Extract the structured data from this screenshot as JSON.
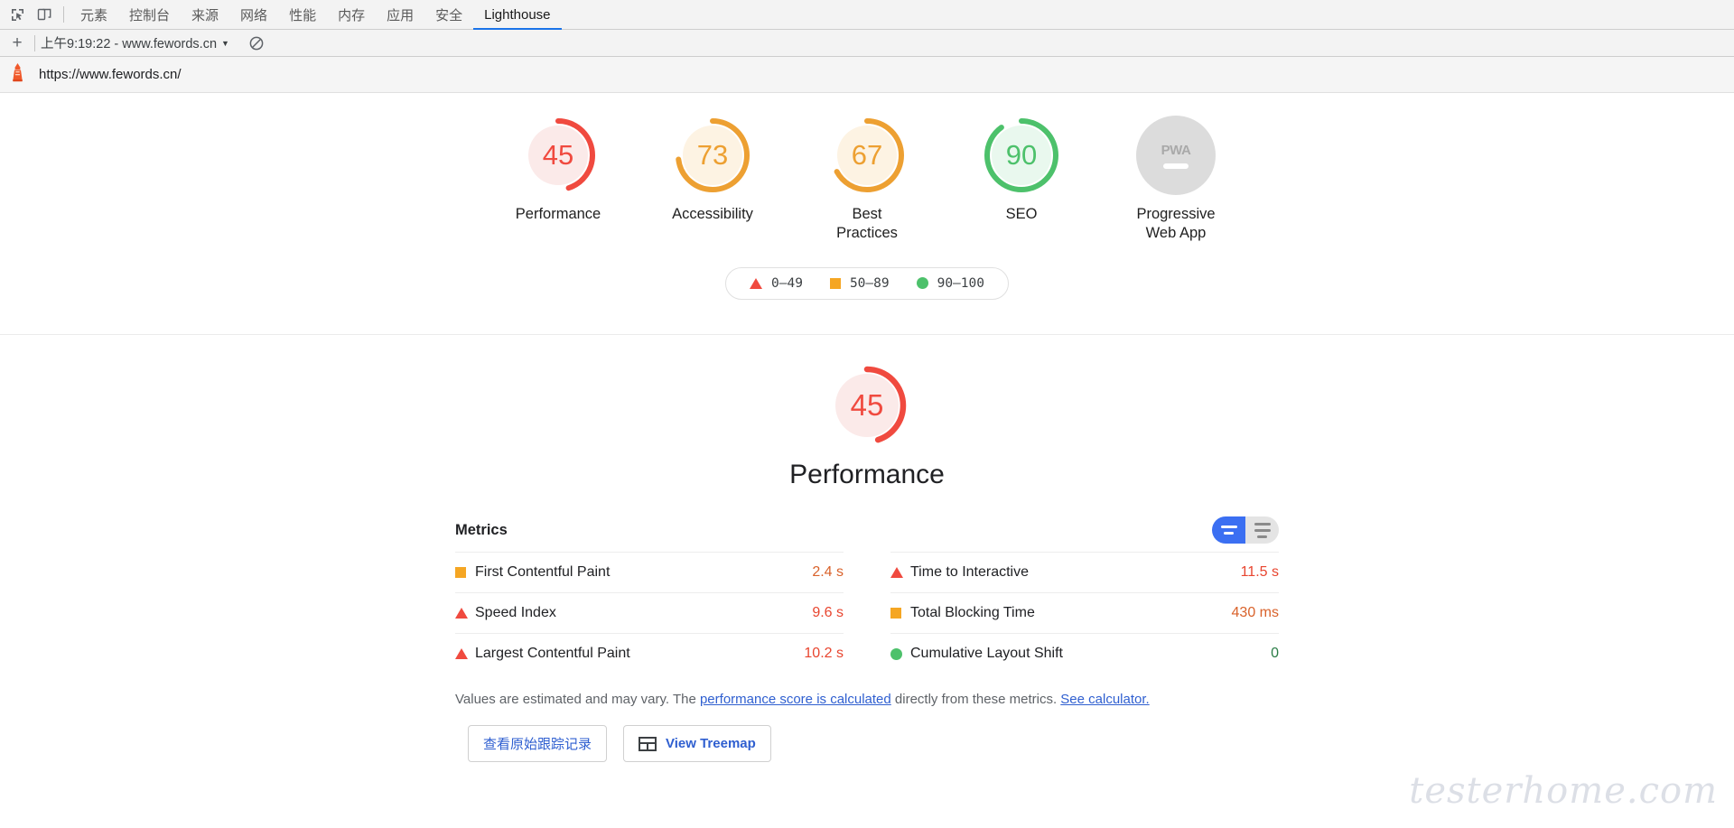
{
  "devtools": {
    "icons": {
      "inspect": "inspect-element-icon",
      "device": "device-toolbar-icon"
    },
    "tabs": [
      {
        "label": "元素",
        "selected": false
      },
      {
        "label": "控制台",
        "selected": false
      },
      {
        "label": "来源",
        "selected": false
      },
      {
        "label": "网络",
        "selected": false
      },
      {
        "label": "性能",
        "selected": false
      },
      {
        "label": "内存",
        "selected": false
      },
      {
        "label": "应用",
        "selected": false
      },
      {
        "label": "安全",
        "selected": false
      },
      {
        "label": "Lighthouse",
        "selected": true
      }
    ]
  },
  "lh_toolbar": {
    "add_label": "+",
    "run_label": "上午9:19:22 - www.fewords.cn",
    "caret": "▼",
    "clear_icon": "clear-all-icon"
  },
  "url_bar": {
    "icon": "lighthouse-logo-icon",
    "url": "https://www.fewords.cn/"
  },
  "chart_data": {
    "type": "gauge",
    "title": "Lighthouse category scores",
    "categories": [
      "Performance",
      "Accessibility",
      "Best Practices",
      "SEO",
      "Progressive Web App"
    ],
    "values": [
      45,
      73,
      67,
      90,
      null
    ],
    "ylim": [
      0,
      100
    ],
    "legend": [
      "0–49",
      "50–89",
      "90–100"
    ],
    "colors": {
      "fail": "#f04a3f",
      "average": "#f5a623",
      "pass": "#4dc16b",
      "null": "#dcdcdc"
    }
  },
  "gauges": [
    {
      "score": "45",
      "label": "Performance",
      "value": 45,
      "band": "fail"
    },
    {
      "score": "73",
      "label": "Accessibility",
      "value": 73,
      "band": "average"
    },
    {
      "score": "67",
      "label": "Best\nPractices",
      "value": 67,
      "band": "average"
    },
    {
      "score": "90",
      "label": "SEO",
      "value": 90,
      "band": "pass"
    },
    {
      "score": "PWA",
      "label": "Progressive\nWeb App",
      "value": null,
      "band": "null"
    }
  ],
  "gauge_labels": {
    "performance": "Performance",
    "accessibility": "Accessibility",
    "best_practices_line1": "Best",
    "best_practices_line2": "Practices",
    "seo": "SEO",
    "pwa_line1": "Progressive",
    "pwa_line2": "Web App",
    "pwa_badge": "PWA"
  },
  "gauge_scores": {
    "performance": "45",
    "accessibility": "73",
    "best_practices": "67",
    "seo": "90"
  },
  "legend": {
    "fail": "0–49",
    "average": "50–89",
    "pass": "90–100"
  },
  "category": {
    "score": "45",
    "title": "Performance"
  },
  "metrics": {
    "heading": "Metrics",
    "toggle": {
      "compact_label": "toggle-compact",
      "expanded_label": "toggle-expanded",
      "selected": "compact"
    },
    "left_column": [
      {
        "label": "First Contentful Paint",
        "value": "2.4 s",
        "band": "average"
      },
      {
        "label": "Speed Index",
        "value": "9.6 s",
        "band": "fail"
      },
      {
        "label": "Largest Contentful Paint",
        "value": "10.2 s",
        "band": "fail"
      }
    ],
    "right_column": [
      {
        "label": "Time to Interactive",
        "value": "11.5 s",
        "band": "fail"
      },
      {
        "label": "Total Blocking Time",
        "value": "430 ms",
        "band": "average"
      },
      {
        "label": "Cumulative Layout Shift",
        "value": "0",
        "band": "pass"
      }
    ]
  },
  "metric_rows": {
    "l0_label": "First Contentful Paint",
    "l0_value": "2.4 s",
    "l1_label": "Speed Index",
    "l1_value": "9.6 s",
    "l2_label": "Largest Contentful Paint",
    "l2_value": "10.2 s",
    "r0_label": "Time to Interactive",
    "r0_value": "11.5 s",
    "r1_label": "Total Blocking Time",
    "r1_value": "430 ms",
    "r2_label": "Cumulative Layout Shift",
    "r2_value": "0"
  },
  "footnote": {
    "part1": "Values are estimated and may vary. The ",
    "link1": "performance score is calculated",
    "part2": " directly from these metrics. ",
    "link2": "See calculator."
  },
  "buttons": {
    "view_trace": "查看原始跟踪记录",
    "view_treemap": "View Treemap",
    "treemap_icon": "treemap-icon"
  },
  "watermark": "testerhome.com"
}
